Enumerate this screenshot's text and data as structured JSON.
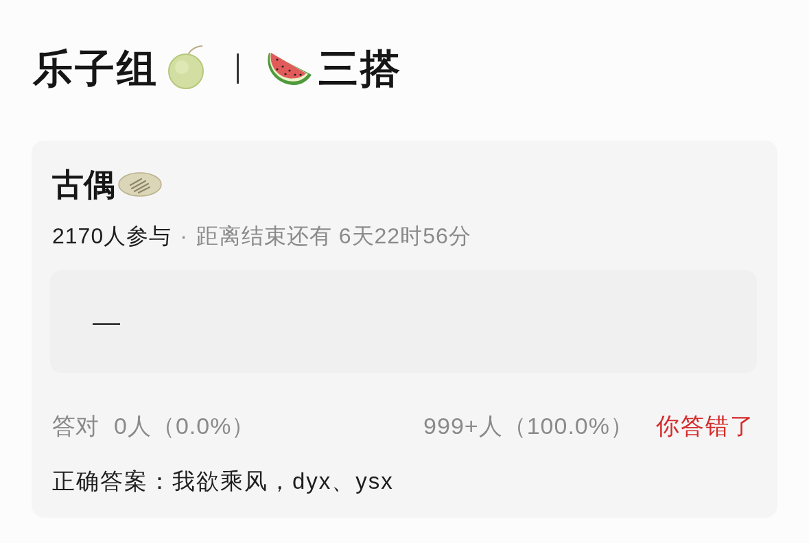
{
  "header": {
    "group": "乐子组",
    "tag": "三搭"
  },
  "card": {
    "title": "古偶",
    "participants": "2170人参与",
    "separator": "·",
    "countdown": "距离结束还有 6天22时56分",
    "answer": "—",
    "stats": {
      "correct_label": "答对",
      "correct_count": "0人（0.0%）",
      "wrong_count": "999+人（100.0%）",
      "result": {
        "text": "你答错了",
        "correct": false
      }
    },
    "correct_answer": "正确答案：我欲乘风，dyx、ysx"
  }
}
